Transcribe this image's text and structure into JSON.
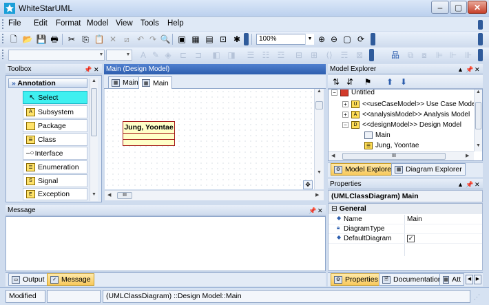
{
  "window": {
    "title": "WhiteStarUML",
    "minimize": "–",
    "maximize": "▢",
    "close": "✕"
  },
  "menubar": {
    "items": [
      "File",
      "Edit",
      "Format",
      "Model",
      "View",
      "Tools",
      "Help"
    ]
  },
  "toolbar": {
    "zoom_value": "100%"
  },
  "toolbox": {
    "title": "Toolbox",
    "category": "Annotation",
    "items": [
      "Select",
      "Subsystem",
      "Package",
      "Class",
      "Interface",
      "Enumeration",
      "Signal",
      "Exception"
    ]
  },
  "editor": {
    "title": "Main (Design Model)",
    "tabs": [
      "Main",
      "Main"
    ],
    "class_name": "Jung, Yoontae",
    "hscroll_label": "III"
  },
  "model_explorer": {
    "title": "Model Explorer",
    "tree": [
      {
        "label": "Untitled",
        "expander": "−"
      },
      {
        "label": "<<useCaseModel>> Use Case Model",
        "expander": "+"
      },
      {
        "label": "<<analysisModel>> Analysis Model",
        "expander": "+"
      },
      {
        "label": "<<designModel>> Design Model",
        "expander": "−"
      },
      {
        "label": "Main",
        "expander": ""
      },
      {
        "label": "Jung, Yoontae",
        "expander": ""
      }
    ],
    "hscroll_label": "III",
    "tabs": [
      "Model Explorer",
      "Diagram Explorer"
    ]
  },
  "properties": {
    "title": "Properties",
    "selection": "(UMLClassDiagram) Main",
    "section": "General",
    "rows": [
      {
        "key": "Name",
        "value": "Main"
      },
      {
        "key": "DiagramType",
        "value": ""
      },
      {
        "key": "DefaultDiagram",
        "value": "✓"
      }
    ],
    "tabs": [
      "Properties",
      "Documentation",
      "Att"
    ]
  },
  "message": {
    "title": "Message",
    "tabs": [
      "Output",
      "Message"
    ]
  },
  "statusbar": {
    "mode": "Modified",
    "path": "(UMLClassDiagram) ::Design Model::Main"
  },
  "colors": {
    "accent": "#2e5fae",
    "selection": "#3ff0f0",
    "class_fill": "#ffffc8",
    "class_border": "#a31515"
  }
}
